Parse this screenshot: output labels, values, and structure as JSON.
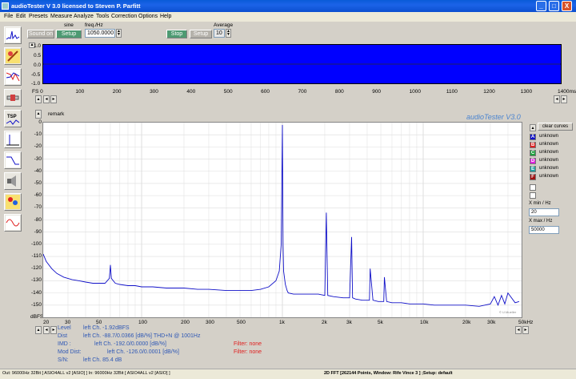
{
  "window": {
    "title": "audioTester  V 3.0   licensed to Steven P. Parfitt",
    "controls": {
      "minimize": "_",
      "maximize": "□",
      "close": "X"
    }
  },
  "menu": [
    "File",
    "Edit",
    "Presets",
    "Measure",
    "Analyze",
    "Tools",
    "Correction",
    "Options",
    "Help"
  ],
  "toolbar": {
    "sound_on": "Sound on",
    "signal_label": "sine",
    "setup": "Setup",
    "freq_label": "freq./Hz",
    "freq_value": "1050.0000",
    "stop": "Stop",
    "setup2": "Setup",
    "average_label": "Average",
    "average_value": "10"
  },
  "scope": {
    "y_ticks": [
      "1.0",
      "0.5",
      "0.0",
      "-0.5",
      "-1.0"
    ],
    "x_ticks": [
      "FS 0",
      "100",
      "200",
      "300",
      "400",
      "500",
      "600",
      "700",
      "800",
      "900",
      "1000",
      "1100",
      "1200",
      "1300",
      "1400ms"
    ]
  },
  "fft": {
    "remark": "remark",
    "watermark": "audioTester  V3.0",
    "credit": "© U.Mueller",
    "y_top_label": "dBFS"
  },
  "legend": {
    "clear_curves": "clear curves",
    "curves": [
      {
        "letter": "A",
        "label": "unknown",
        "color": "#1010c8"
      },
      {
        "letter": "B",
        "label": "unknown",
        "color": "#e02020"
      },
      {
        "letter": "C",
        "label": "unknown",
        "color": "#20a040"
      },
      {
        "letter": "D",
        "label": "unknown",
        "color": "#e020e0"
      },
      {
        "letter": "E",
        "label": "unknown",
        "color": "#20a0a0"
      },
      {
        "letter": "F",
        "label": "unknown",
        "color": "#a01010"
      }
    ],
    "xmin_label": "X min / Hz",
    "xmin_value": "20",
    "xmax_label": "X max / Hz",
    "xmax_value": "50000"
  },
  "readout": {
    "level_label": "Level",
    "level_value": "left Ch. -1.92dBFS",
    "dist_label": "Dist",
    "dist_value": "left Ch. -88.7/0.0366 [dB/%] THD+N  @ 1001Hz",
    "imd_label": "IMD :",
    "imd_value": "left Ch. -192.0/0.0000 [dB/%]",
    "mod_label": "Mod Dist:",
    "mod_value": "left Ch. -126.0/0.0001 [dB/%]",
    "sn_label": "S/N:",
    "sn_value": "left Ch. 85.4 dB",
    "filter1": "Filter: none",
    "filter2": "Filter: none"
  },
  "status": {
    "left": "Out: 96000Hz 32Bit  [ ASIO4ALL v2 [ASIO] ]  In: 96000Hz 32Bit  [ ASIO4ALL v2 [ASIO] ]",
    "right": "2D FFT [262144 Points, Window: Rife Vince 3 ] ;Setup:  default"
  },
  "chart_data": {
    "type": "line",
    "xscale": "log",
    "xlim": [
      20,
      50000
    ],
    "ylim": [
      -160,
      0
    ],
    "ylabel": "dBFS",
    "x_tick_labels": [
      "20",
      "30",
      "50",
      "100",
      "200",
      "300",
      "500",
      "1k",
      "2k",
      "3k",
      "5k",
      "10k",
      "20k",
      "30k",
      "50kHz"
    ],
    "y_tick_labels": [
      "0",
      "-10",
      "-20",
      "-30",
      "-40",
      "-50",
      "-60",
      "-70",
      "-80",
      "-90",
      "-100",
      "-110",
      "-120",
      "-130",
      "-140",
      "-150"
    ],
    "grid": true,
    "series": [
      {
        "color": "#1010c8",
        "x": [
          20,
          21,
          23,
          25,
          28,
          32,
          36,
          40,
          45,
          50,
          55,
          59,
          60,
          61,
          65,
          70,
          80,
          90,
          100,
          120,
          150,
          180,
          200,
          250,
          300,
          400,
          500,
          600,
          700,
          800,
          900,
          950,
          980,
          1000,
          1010,
          1020,
          1050,
          1080,
          1100,
          1200,
          1500,
          1800,
          2000,
          2050,
          2100,
          2300,
          2700,
          3000,
          3100,
          3150,
          3300,
          3700,
          4000,
          4150,
          4200,
          4400,
          4800,
          5000,
          5250,
          5300,
          5500,
          6000,
          7000,
          8000,
          10000,
          12000,
          15000,
          20000,
          25000,
          30000,
          32000,
          34000,
          36000,
          38000,
          40000,
          45000,
          48000
        ],
        "y": [
          -108,
          -114,
          -120,
          -124,
          -127,
          -129,
          -130,
          -131,
          -132,
          -132,
          -132,
          -128,
          -117,
          -128,
          -132,
          -133,
          -134,
          -134,
          -135,
          -135,
          -136,
          -136,
          -136,
          -137,
          -137,
          -138,
          -138,
          -138,
          -137,
          -135,
          -130,
          -122,
          -100,
          -2,
          -100,
          -122,
          -133,
          -138,
          -140,
          -141,
          -141,
          -141,
          -142,
          -74,
          -142,
          -143,
          -144,
          -144,
          -94,
          -144,
          -145,
          -146,
          -146,
          -146,
          -120,
          -146,
          -147,
          -147,
          -147,
          -127,
          -147,
          -148,
          -148,
          -149,
          -149,
          -150,
          -150,
          -150,
          -151,
          -149,
          -143,
          -150,
          -142,
          -149,
          -140,
          -148,
          -147
        ]
      }
    ]
  }
}
